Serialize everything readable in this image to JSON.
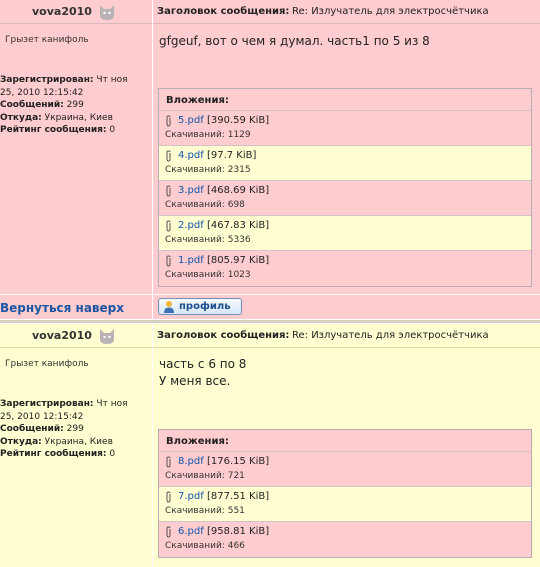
{
  "labels": {
    "subject": "Заголовок сообщения:",
    "registered": "Зарегистрирован:",
    "messages": "Сообщений:",
    "from": "Откуда:",
    "rating": "Рейтинг сообщения:",
    "attachments": "Вложения:",
    "downloads": "Скачиваний:",
    "back_to_top": "Вернуться наверх",
    "profile": "профиль"
  },
  "posts": [
    {
      "username": "vova2010",
      "subject": "Re: Излучатель для электросчётчика",
      "rank": "Грызет канифоль",
      "registered": "Чт ноя",
      "registered2": "25, 2010 12:15:42",
      "messages": "299",
      "from": "Украина, Киев",
      "rating": "0",
      "text_lines": [
        "gfgeuf, вот о чем я думал. часть1 по 5 из 8"
      ],
      "attachments": [
        {
          "name": "5.pdf",
          "size": "[390.59 KiB]",
          "downloads": "1129"
        },
        {
          "name": "4.pdf",
          "size": "[97.7 KiB]",
          "downloads": "2315"
        },
        {
          "name": "3.pdf",
          "size": "[468.69 KiB]",
          "downloads": "698"
        },
        {
          "name": "2.pdf",
          "size": "[467.83 KiB]",
          "downloads": "5336"
        },
        {
          "name": "1.pdf",
          "size": "[805.97 KiB]",
          "downloads": "1023"
        }
      ]
    },
    {
      "username": "vova2010",
      "subject": "Re: Излучатель для электросчётчика",
      "rank": "Грызет канифоль",
      "registered": "Чт ноя",
      "registered2": "25, 2010 12:15:42",
      "messages": "299",
      "from": "Украина, Киев",
      "rating": "0",
      "text_lines": [
        "часть с 6 по 8",
        "У меня все."
      ],
      "attachments": [
        {
          "name": "8.pdf",
          "size": "[176.15 KiB]",
          "downloads": "721"
        },
        {
          "name": "7.pdf",
          "size": "[877.51 KiB]",
          "downloads": "551"
        },
        {
          "name": "6.pdf",
          "size": "[958.81 KiB]",
          "downloads": "466"
        }
      ]
    }
  ]
}
